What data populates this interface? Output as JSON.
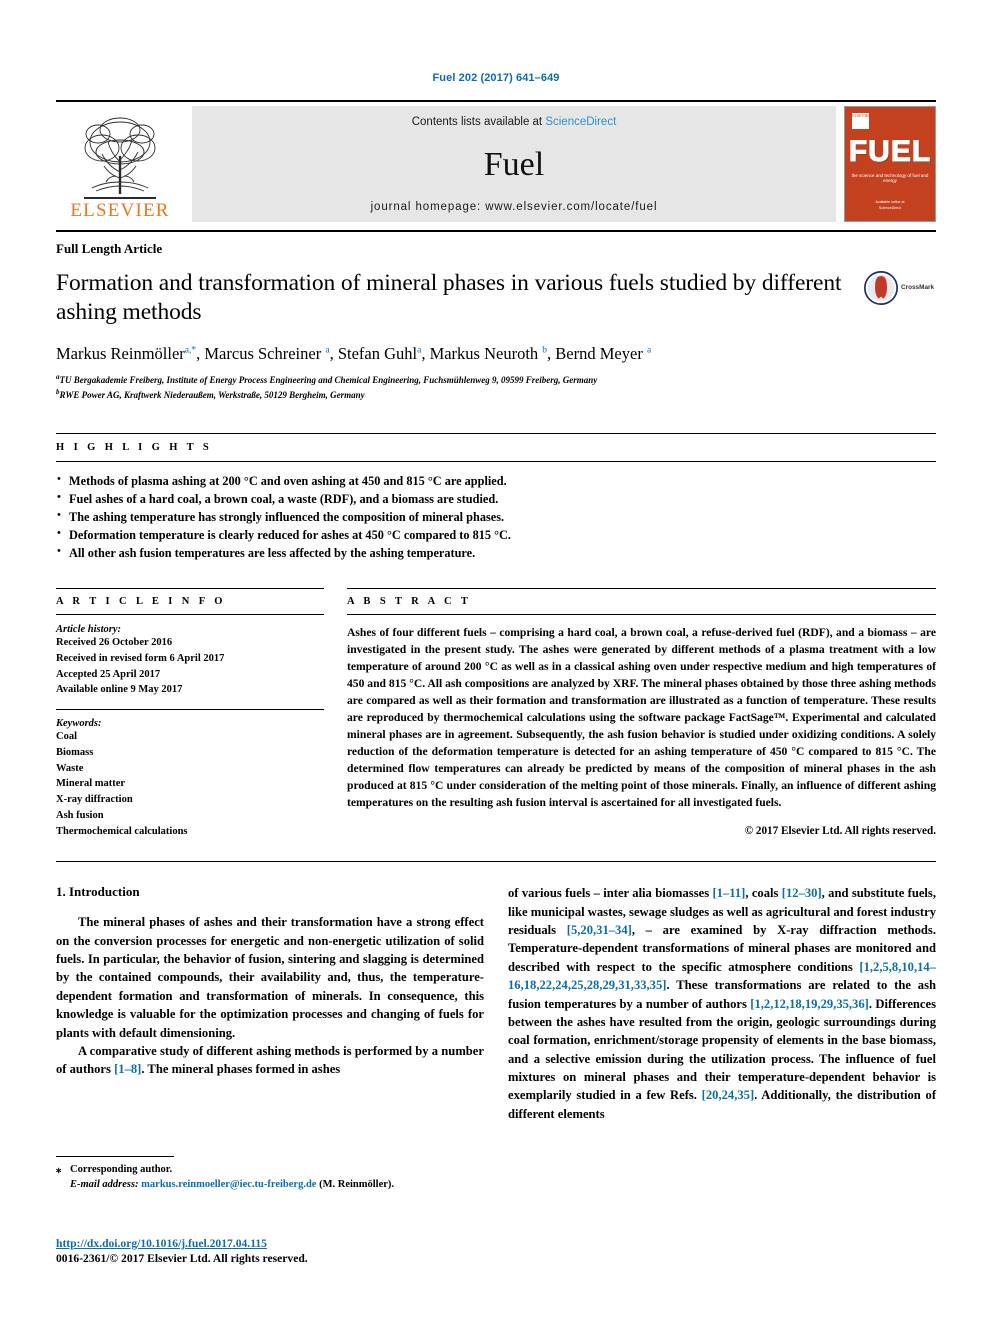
{
  "running_head": "Fuel 202 (2017) 641–649",
  "masthead": {
    "publisher_name": "ELSEVIER",
    "contents_prefix": "Contents lists available at ",
    "contents_link": "ScienceDirect",
    "journal_name": "Fuel",
    "homepage": "journal homepage: www.elsevier.com/locate/fuel",
    "cover": {
      "title": "FUEL",
      "subtitle": "the science and technology of fuel and energy",
      "corner_label": "ELSEVIER",
      "bottom_note": "Available online at\nScienceDirect"
    }
  },
  "article": {
    "type": "Full Length Article",
    "title": "Formation and transformation of mineral phases in various fuels studied by different ashing methods",
    "crossmark_label": "CrossMark",
    "authors_html": "Markus Reinmöller<sup>a,*</sup>, Marcus Schreiner <sup>a</sup>, Stefan Guhl<sup>a</sup>, Markus Neuroth <sup>b</sup>, Bernd Meyer <sup>a</sup>",
    "affiliations": [
      "TU Bergakademie Freiberg, Institute of Energy Process Engineering and Chemical Engineering, Fuchsmühlenweg 9, 09599 Freiberg, Germany",
      "RWE Power AG, Kraftwerk Niederaußem, Werkstraße, 50129 Bergheim, Germany"
    ],
    "affiliation_marks": [
      "a",
      "b"
    ]
  },
  "highlights": {
    "label": "H I G H L I G H T S",
    "items": [
      "Methods of plasma ashing at 200 °C and oven ashing at 450 and 815 °C are applied.",
      "Fuel ashes of a hard coal, a brown coal, a waste (RDF), and a biomass are studied.",
      "The ashing temperature has strongly influenced the composition of mineral phases.",
      "Deformation temperature is clearly reduced for ashes at 450 °C compared to 815 °C.",
      "All other ash fusion temperatures are less affected by the ashing temperature."
    ]
  },
  "article_info": {
    "label": "A R T I C L E   I N F O",
    "history_title": "Article history:",
    "history": [
      "Received 26 October 2016",
      "Received in revised form 6 April 2017",
      "Accepted 25 April 2017",
      "Available online 9 May 2017"
    ],
    "keywords_title": "Keywords:",
    "keywords": [
      "Coal",
      "Biomass",
      "Waste",
      "Mineral matter",
      "X-ray diffraction",
      "Ash fusion",
      "Thermochemical calculations"
    ]
  },
  "abstract": {
    "label": "A B S T R A C T",
    "text": "Ashes of four different fuels – comprising a hard coal, a brown coal, a refuse-derived fuel (RDF), and a biomass – are investigated in the present study. The ashes were generated by different methods of a plasma treatment with a low temperature of around 200 °C as well as in a classical ashing oven under respective medium and high temperatures of 450 and 815 °C. All ash compositions are analyzed by XRF. The mineral phases obtained by those three ashing methods are compared as well as their formation and transformation are illustrated as a function of temperature. These results are reproduced by thermochemical calculations using the software package FactSage™. Experimental and calculated mineral phases are in agreement. Subsequently, the ash fusion behavior is studied under oxidizing conditions. A solely reduction of the deformation temperature is detected for an ashing temperature of 450 °C compared to 815 °C. The determined flow temperatures can already be predicted by means of the composition of mineral phases in the ash produced at 815 °C under consideration of the melting point of those minerals. Finally, an influence of different ashing temperatures on the resulting ash fusion interval is ascertained for all investigated fuels.",
    "copyright": "© 2017 Elsevier Ltd. All rights reserved."
  },
  "introduction": {
    "heading": "1. Introduction",
    "left_paragraphs": [
      "The mineral phases of ashes and their transformation have a strong effect on the conversion processes for energetic and non-energetic utilization of solid fuels. In particular, the behavior of fusion, sintering and slagging is determined by the contained compounds, their availability and, thus, the temperature-dependent formation and transformation of minerals. In consequence, this knowledge is valuable for the optimization processes and changing of fuels for plants with default dimensioning."
    ],
    "left_paragraph2_pre": "A comparative study of different ashing methods is performed by a number of authors ",
    "left_paragraph2_ref": "[1–8]",
    "left_paragraph2_post": ". The mineral phases formed in ashes",
    "right_segments": [
      {
        "t": "of various fuels – inter alia biomasses ",
        "link": false
      },
      {
        "t": "[1–11]",
        "link": true
      },
      {
        "t": ", coals ",
        "link": false
      },
      {
        "t": "[12–30]",
        "link": true
      },
      {
        "t": ", and substitute fuels, like municipal wastes, sewage sludges as well as agricultural and forest industry residuals ",
        "link": false
      },
      {
        "t": "[5,20,31–34]",
        "link": true
      },
      {
        "t": ", – are examined by X-ray diffraction methods. Temperature-dependent transformations of mineral phases are monitored and described with respect to the specific atmosphere conditions ",
        "link": false
      },
      {
        "t": "[1,2,5,8,10,14–16,18,22,24,25,28,29,31,33,35]",
        "link": true
      },
      {
        "t": ". These transformations are related to the ash fusion temperatures by a number of authors ",
        "link": false
      },
      {
        "t": "[1,2,12,18,19,29,35,36]",
        "link": true
      },
      {
        "t": ". Differences between the ashes have resulted from the origin, geologic surroundings during coal formation, enrichment/storage propensity of elements in the base biomass, and a selective emission during the utilization process. The influence of fuel mixtures on mineral phases and their temperature-dependent behavior is exemplarily studied in a few Refs. ",
        "link": false
      },
      {
        "t": "[20,24,35]",
        "link": true
      },
      {
        "t": ". Additionally, the distribution of different elements",
        "link": false
      }
    ]
  },
  "footnote": {
    "corresponding_marker": "⁎",
    "corresponding_text": "Corresponding author.",
    "email_label": "E-mail address:",
    "email": "markus.reinmoeller@iec.tu-freiberg.de",
    "email_suffix": "(M. Reinmöller)."
  },
  "footer": {
    "doi": "http://dx.doi.org/10.1016/j.fuel.2017.04.115",
    "issn_line": "0016-2361/© 2017 Elsevier Ltd. All rights reserved."
  },
  "colors": {
    "link": "#0b6ea8",
    "elsevier_orange": "#e87722",
    "sciencedirect_blue": "#2f8fce",
    "cover_red": "#c4411f",
    "masthead_grey": "#e6e6e6"
  }
}
